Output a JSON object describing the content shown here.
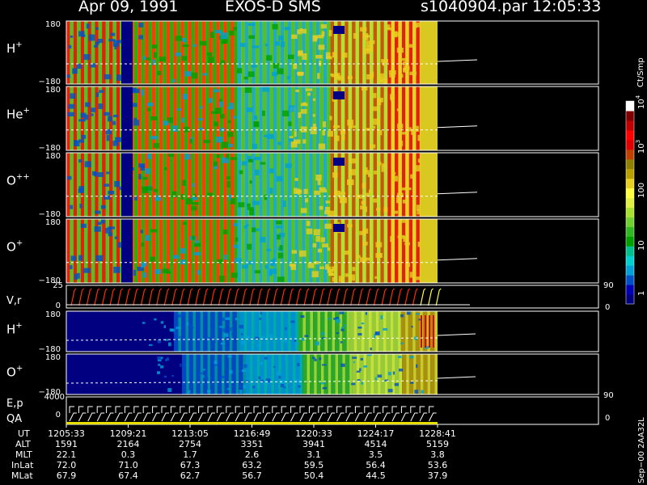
{
  "header": {
    "date": "Apr 09, 1991",
    "mission": "EXOS-D SMS",
    "file": "s1040904.par",
    "time": "12:05:33"
  },
  "colorbar": {
    "unit": "Ct/Smp",
    "ticks": [
      "1",
      "10",
      "100",
      "10",
      "10"
    ],
    "tick_exp": [
      "",
      "",
      "",
      "3",
      "4"
    ],
    "colors": [
      "#000080",
      "#0000b4",
      "#0050c8",
      "#00a0d8",
      "#00d0d0",
      "#00c090",
      "#00a000",
      "#30b820",
      "#70d030",
      "#a8e030",
      "#e0f040",
      "#ffff40",
      "#e8d020",
      "#b8a000",
      "#908000",
      "#c04000",
      "#e00000",
      "#ff0000",
      "#c00000",
      "#800000",
      "#ffffff"
    ]
  },
  "panels": [
    {
      "label": "H",
      "sup": "+",
      "top": "180",
      "bottom": "−180"
    },
    {
      "label": "He",
      "sup": "+",
      "top": "180",
      "bottom": "−180"
    },
    {
      "label": "O",
      "sup": "++",
      "top": "180",
      "bottom": "−180"
    },
    {
      "label": "O",
      "sup": "+",
      "top": "180",
      "bottom": "−180"
    }
  ],
  "vr_panel": {
    "label": "V,r",
    "top": "25",
    "bottom": "0",
    "right_top": "90",
    "right_bottom": "0"
  },
  "lower_panels": [
    {
      "label": "H",
      "sup": "+",
      "top": "180",
      "bottom": "−180"
    },
    {
      "label": "O",
      "sup": "+",
      "top": "180",
      "bottom": "−180"
    }
  ],
  "ep_panel": {
    "label1": "E,p",
    "label2": "QA",
    "top": "4000",
    "bottom": "0",
    "right_top": "90",
    "right_bottom": "0"
  },
  "side_text": "Sep−00  2AA32L",
  "chart_data": {
    "type": "heatmap",
    "x_axis": "UT",
    "x": [
      "1205:33",
      "1209:21",
      "1213:05",
      "1216:49",
      "1220:33",
      "1224:17",
      "1228:41"
    ],
    "y_range_pitch_angle": [
      -180,
      180
    ],
    "z_unit": "Ct/Smp",
    "z_scale": "log",
    "z_range": [
      1,
      10000
    ],
    "series": [
      {
        "name": "H+"
      },
      {
        "name": "He+"
      },
      {
        "name": "O++"
      },
      {
        "name": "O+"
      },
      {
        "name": "V,r"
      },
      {
        "name": "H+"
      },
      {
        "name": "O+"
      },
      {
        "name": "E,p"
      }
    ],
    "table": {
      "rows": [
        {
          "name": "UT",
          "values": [
            "1205:33",
            "1209:21",
            "1213:05",
            "1216:49",
            "1220:33",
            "1224:17",
            "1228:41"
          ]
        },
        {
          "name": "ALT",
          "values": [
            "1591",
            "2164",
            "2754",
            "3351",
            "3941",
            "4514",
            "5159"
          ]
        },
        {
          "name": "MLT",
          "values": [
            "22.1",
            "0.3",
            "1.7",
            "2.6",
            "3.1",
            "3.5",
            "3.8"
          ]
        },
        {
          "name": "InLat",
          "values": [
            "72.0",
            "71.0",
            "67.3",
            "63.2",
            "59.5",
            "56.4",
            "53.6"
          ]
        },
        {
          "name": "MLat",
          "values": [
            "67.9",
            "67.4",
            "62.7",
            "56.7",
            "50.4",
            "44.5",
            "37.9"
          ]
        }
      ]
    }
  }
}
